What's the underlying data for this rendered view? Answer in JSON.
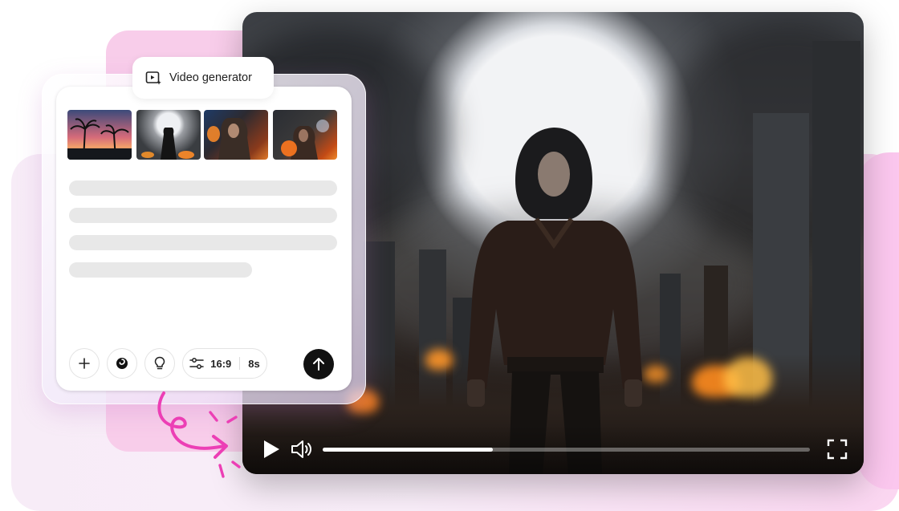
{
  "panel": {
    "tab_title": "Video generator",
    "thumbnails": [
      {
        "name": "palm-sunset-thumbnail"
      },
      {
        "name": "hooded-figure-moon-thumbnail"
      },
      {
        "name": "hooded-warrior-fire-thumbnail"
      },
      {
        "name": "warrior-flames-thumbnail"
      }
    ],
    "toolbar": {
      "aspect_ratio": "16:9",
      "duration": "8s"
    }
  },
  "player": {
    "progress_fraction": 0.35
  },
  "colors": {
    "accent_pink": "#ec3fb5",
    "send_button": "#111111",
    "skeleton": "#e8e8e8"
  },
  "icons": {
    "tab": "video-sparkle-icon",
    "add": "plus-icon",
    "style": "swirl-icon",
    "idea": "lightbulb-icon",
    "settings": "sliders-icon",
    "send": "arrow-up-icon",
    "play": "play-icon",
    "volume": "volume-icon",
    "fullscreen": "fullscreen-icon"
  }
}
